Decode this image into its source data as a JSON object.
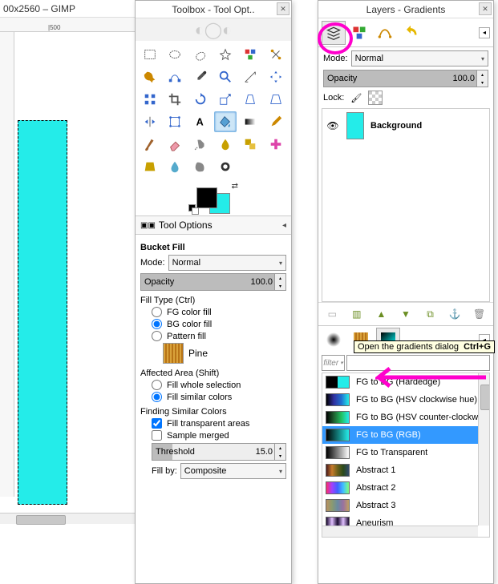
{
  "app": {
    "title_fragment": "00x2560 – GIMP"
  },
  "ruler": {
    "top_mark": "|500"
  },
  "toolbox": {
    "title": "Toolbox - Tool Opt..",
    "tools": [
      "rect-select",
      "ellipse-select",
      "free-select",
      "fuzzy-select",
      "by-color-select",
      "intelligent-scissors",
      "foreground-select",
      "paths",
      "color-picker",
      "zoom",
      "measure",
      "move",
      "align",
      "crop",
      "rotate",
      "scale",
      "shear",
      "perspective",
      "flip",
      "cage",
      "text",
      "bucket-fill",
      "blend",
      "pencil",
      "paintbrush",
      "eraser",
      "airbrush",
      "ink",
      "clone",
      "heal",
      "perspective-clone",
      "blur-sharpen",
      "smudge",
      "dodge-burn"
    ],
    "active_tool": "bucket-fill",
    "swap_glyph": "⇄"
  },
  "tool_options": {
    "header": "Tool Options",
    "title": "Bucket Fill",
    "mode_label": "Mode:",
    "mode_value": "Normal",
    "opacity_label": "Opacity",
    "opacity_value": "100.0",
    "fill_type_label": "Fill Type  (Ctrl)",
    "fill_fg": "FG color fill",
    "fill_bg": "BG color fill",
    "fill_pattern": "Pattern fill",
    "pattern_name": "Pine",
    "affected_label": "Affected Area   (Shift)",
    "fill_whole": "Fill whole selection",
    "fill_similar": "Fill similar colors",
    "finding_label": "Finding Similar Colors",
    "fill_transparent": "Fill transparent areas",
    "sample_merged": "Sample merged",
    "threshold_label": "Threshold",
    "threshold_value": "15.0",
    "fill_by_label": "Fill by:",
    "fill_by_value": "Composite"
  },
  "layers": {
    "title": "Layers - Gradients",
    "tabs": [
      "layers",
      "channels",
      "paths",
      "undo"
    ],
    "mode_label": "Mode:",
    "mode_value": "Normal",
    "opacity_label": "Opacity",
    "opacity_value": "100.0",
    "lock_label": "Lock:",
    "layer_name": "Background",
    "buttons": [
      "new",
      "open",
      "up",
      "down",
      "duplicate",
      "anchor",
      "delete"
    ]
  },
  "gradients": {
    "tabs": [
      "brushes",
      "patterns",
      "gradients"
    ],
    "tooltip_text": "Open the gradients dialog",
    "tooltip_shortcut": "Ctrl+G",
    "filter_label": "filter",
    "items": [
      {
        "name": "FG to BG (Hardedge)",
        "css": "linear-gradient(90deg,#000 0 50%,#24ece9 50% 100%)"
      },
      {
        "name": "FG to BG (HSV clockwise hue)",
        "css": "linear-gradient(90deg,#000,#3030a0,#2070d0,#24ece9)"
      },
      {
        "name": "FG to BG (HSV counter-clockwise hue)",
        "css": "linear-gradient(90deg,#000,#206030,#20c060,#24ece9)"
      },
      {
        "name": "FG to BG (RGB)",
        "css": "linear-gradient(90deg,#000,#24ece9)",
        "selected": true
      },
      {
        "name": "FG to Transparent",
        "css": "linear-gradient(90deg,#000,rgba(0,0,0,0))"
      },
      {
        "name": "Abstract 1",
        "css": "linear-gradient(90deg,#4a1a1a,#c77b2c,#6a601a,#2a4a1a,#304a6a)"
      },
      {
        "name": "Abstract 2",
        "css": "linear-gradient(90deg,#ff2a6d,#a040ff,#4060ff,#40c0ff,#80ff80)"
      },
      {
        "name": "Abstract 3",
        "css": "linear-gradient(90deg,#b89060,#8a9a70,#6a8aa0,#9a70a0,#c0a060)"
      },
      {
        "name": "Aneurism",
        "css": "linear-gradient(90deg,#1a0a30,#e0c0ff,#1a0a30,#e0c0ff,#1a0a30)"
      }
    ]
  }
}
